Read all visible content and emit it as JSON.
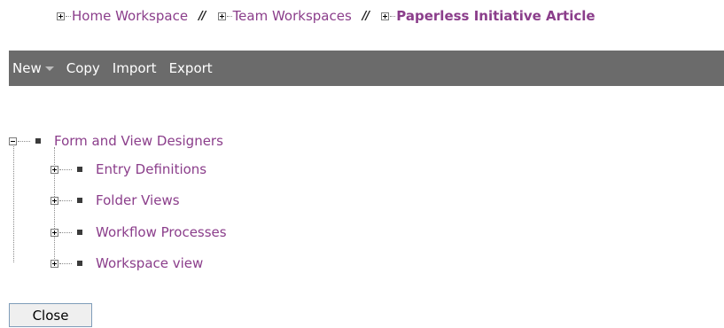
{
  "breadcrumb": {
    "items": [
      {
        "label": "Home Workspace"
      },
      {
        "label": "Team Workspaces"
      },
      {
        "label": "Paperless Initiative Article"
      }
    ],
    "separator": "//"
  },
  "toolbar": {
    "new_label": "New",
    "copy_label": "Copy",
    "import_label": "Import",
    "export_label": "Export"
  },
  "tree": {
    "root": {
      "label": "Form and View Designers"
    },
    "children": [
      {
        "label": "Entry Definitions"
      },
      {
        "label": "Folder Views"
      },
      {
        "label": "Workflow Processes"
      },
      {
        "label": "Workspace view"
      }
    ]
  },
  "close_label": "Close",
  "colors": {
    "link": "#8b3e8b",
    "toolbar_bg": "#6b6b6b",
    "toolbar_text": "#ffffff"
  }
}
